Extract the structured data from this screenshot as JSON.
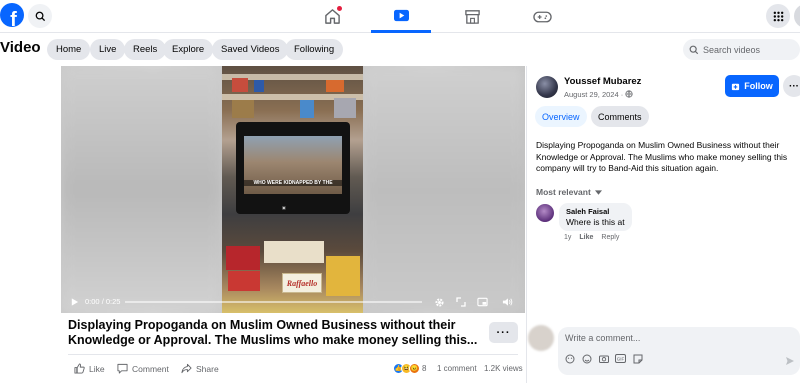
{
  "topnav": {
    "logo": "f",
    "icons": [
      "search-icon",
      "home-icon",
      "video-icon",
      "marketplace-icon",
      "gaming-icon",
      "menu-grid-icon"
    ],
    "active_tab": "video",
    "home_has_notification": true,
    "accent": "#0866ff"
  },
  "subnav": {
    "title": "Video",
    "pills": [
      "Home",
      "Live",
      "Reels",
      "Explore",
      "Saved Videos",
      "Following"
    ],
    "search_placeholder": "Search videos"
  },
  "player": {
    "time_current": "0:00",
    "time_total": "0:25",
    "progress_fraction": 0.0,
    "overlay_caption": "WHO WERE KIDNAPPED BY THE",
    "product_label": "Raffaello"
  },
  "post": {
    "title": "Displaying Propoganda on Muslim Owned Business without their Knowledge or Approval. The Muslims who make money selling this...",
    "more_label": "···",
    "actions": {
      "like": "Like",
      "comment": "Comment",
      "share": "Share"
    },
    "reaction_count": "8",
    "comment_count": "1 comment",
    "view_count": "1.2K views"
  },
  "sidebar": {
    "author": "Youssef Mubarez",
    "date": "August 29, 2024 ·",
    "follow_label": "Follow",
    "more_label": "···",
    "tabs": [
      "Overview",
      "Comments"
    ],
    "description": "Displaying Propoganda on Muslim Owned Business without their Knowledge or Approval. The Muslims who make money selling this company will try to Band-Aid this situation again.",
    "sort_label": "Most relevant",
    "comment": {
      "author": "Saleh Faisal",
      "text": "Where is this at",
      "age": "1y",
      "like": "Like",
      "reply": "Reply"
    },
    "compose_placeholder": "Write a comment..."
  }
}
